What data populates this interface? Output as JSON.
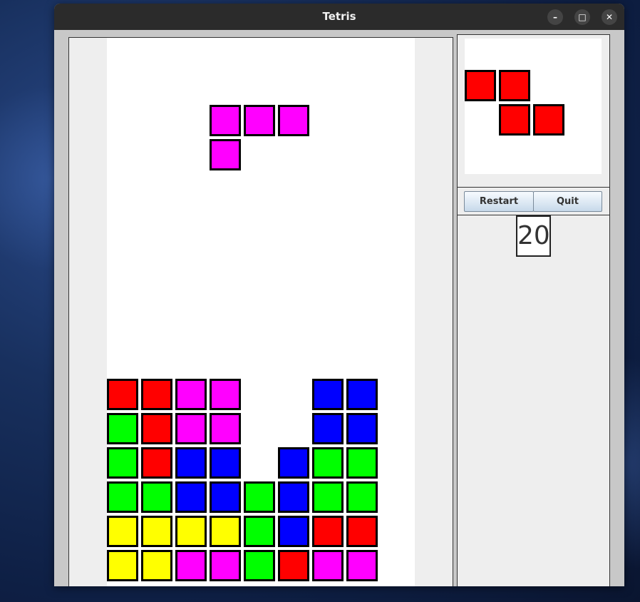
{
  "window": {
    "title": "Tetris"
  },
  "titlebar_buttons": {
    "minimize": "–",
    "maximize": "□",
    "close": "✕"
  },
  "controls": {
    "restart_label": "Restart",
    "quit_label": "Quit"
  },
  "score": "20",
  "colors": {
    "R": "#ff0000",
    "G": "#00ff00",
    "B": "#0000ff",
    "Y": "#ffff00",
    "M": "#ff00ff"
  },
  "board": {
    "columns": 9,
    "rows": 16,
    "cells": [
      ".........",
      ".........",
      "...MMM...",
      "...M.....",
      ".........",
      ".........",
      ".........",
      ".........",
      ".........",
      ".........",
      "RRMM..BB.",
      "GRMM..BB.",
      "GRBB.BGG.",
      "GGBBGBGG.",
      "YYYYGBRR.",
      "YYMMGRMM."
    ]
  },
  "next_piece": {
    "name": "Z",
    "cells": [
      "RR.",
      ".RR"
    ]
  }
}
